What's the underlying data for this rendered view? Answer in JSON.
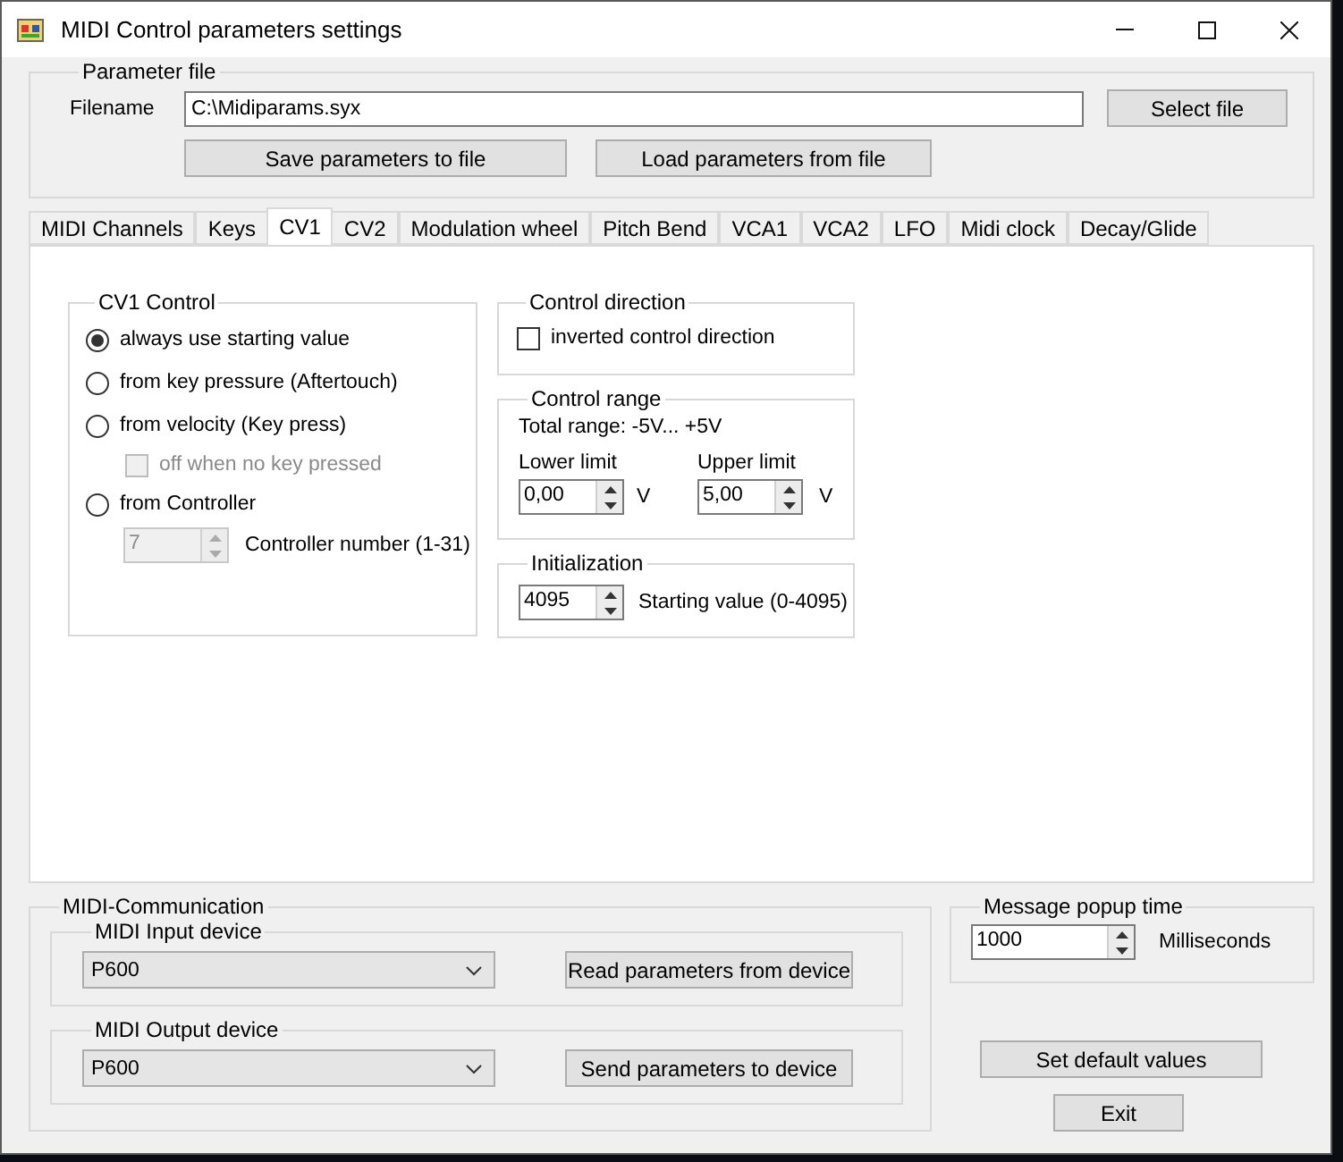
{
  "window": {
    "title": "MIDI Control parameters settings"
  },
  "parameter_file": {
    "title": "Parameter file",
    "filename_label": "Filename",
    "filename": "C:\\Midiparams.syx",
    "select_button": "Select file",
    "save_button": "Save parameters to file",
    "load_button": "Load parameters from file"
  },
  "tabs": [
    {
      "label": "MIDI Channels",
      "selected": false
    },
    {
      "label": "Keys",
      "selected": false
    },
    {
      "label": "CV1",
      "selected": true
    },
    {
      "label": "CV2",
      "selected": false
    },
    {
      "label": "Modulation wheel",
      "selected": false
    },
    {
      "label": "Pitch Bend",
      "selected": false
    },
    {
      "label": "VCA1",
      "selected": false
    },
    {
      "label": "VCA2",
      "selected": false
    },
    {
      "label": "LFO",
      "selected": false
    },
    {
      "label": "Midi clock",
      "selected": false
    },
    {
      "label": "Decay/Glide",
      "selected": false
    }
  ],
  "cv_control": {
    "title": "CV1 Control",
    "options": [
      {
        "label": "always use starting value",
        "selected": true
      },
      {
        "label": "from key pressure (Aftertouch)",
        "selected": false
      },
      {
        "label": "from velocity (Key press)",
        "selected": false
      },
      {
        "label": "from Controller",
        "selected": false
      }
    ],
    "off_when_no_key": {
      "label": "off when no key pressed",
      "checked": false,
      "disabled": true
    },
    "controller_number": {
      "value": "7",
      "label": "Controller number (1-31)",
      "disabled": true
    }
  },
  "control_direction": {
    "title": "Control direction",
    "inverted": {
      "label": "inverted control direction",
      "checked": false
    }
  },
  "control_range": {
    "title": "Control range",
    "total_range": "Total range: -5V... +5V",
    "lower": {
      "label": "Lower limit",
      "value": "0,00",
      "unit": "V"
    },
    "upper": {
      "label": "Upper limit",
      "value": "5,00",
      "unit": "V"
    }
  },
  "initialization": {
    "title": "Initialization",
    "value": "4095",
    "label": "Starting value (0-4095)"
  },
  "midi_communication": {
    "title": "MIDI-Communication",
    "input": {
      "title": "MIDI Input device",
      "device": "P600",
      "button": "Read parameters from device"
    },
    "output": {
      "title": "MIDI Output device",
      "device": "P600",
      "button": "Send parameters to device"
    }
  },
  "message_popup": {
    "title": "Message popup time",
    "value": "1000",
    "unit": "Milliseconds"
  },
  "buttons": {
    "defaults": "Set default values",
    "exit": "Exit"
  }
}
